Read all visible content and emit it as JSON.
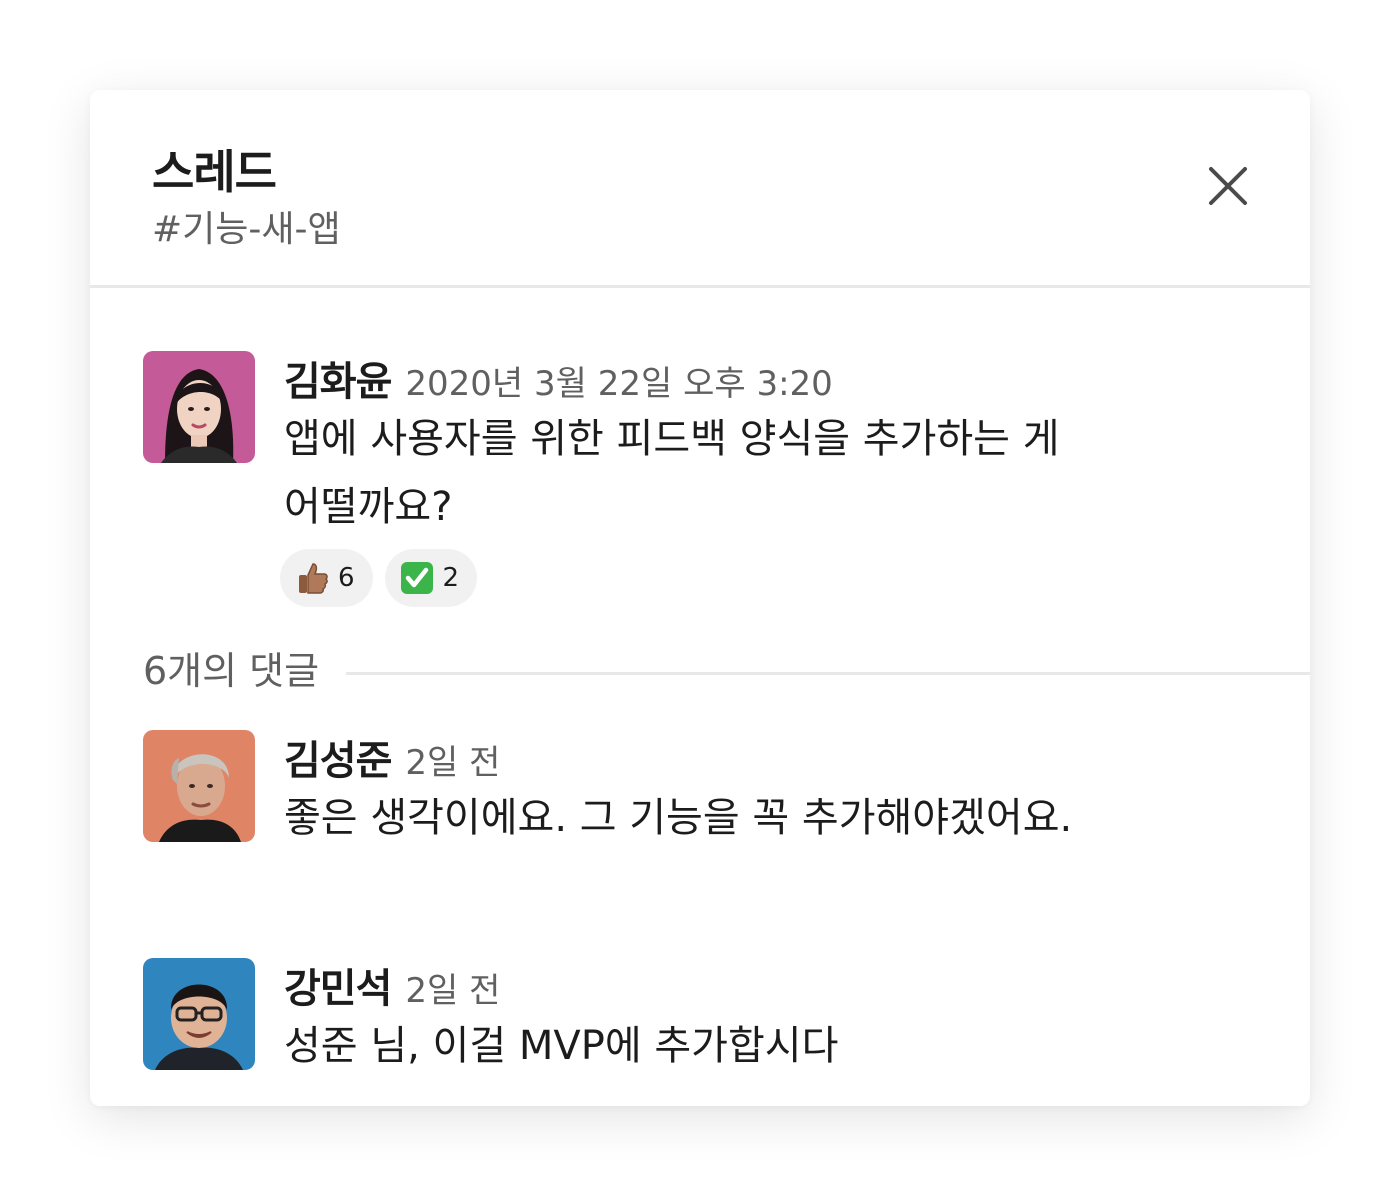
{
  "header": {
    "title": "스레드",
    "channel": "#기능-새-앱",
    "close_icon": "close-icon"
  },
  "parent_message": {
    "author": "김화윤",
    "timestamp": "2020년 3월 22일 오후 3:20",
    "text_line1": "앱에 사용자를 위한 피드백 양식을 추가하는 게",
    "text_line2": "어떨까요?",
    "reactions": [
      {
        "emoji": "thumbs-up-medium-skin-tone",
        "count": "6"
      },
      {
        "emoji": "white-check-mark",
        "count": "2"
      }
    ]
  },
  "replies_label": "6개의 댓글",
  "replies": [
    {
      "author": "김성준",
      "timestamp": "2일 전",
      "text": "좋은 생각이에요. 그 기능을 꼭 추가해야겠어요."
    },
    {
      "author": "강민석",
      "timestamp": "2일 전",
      "text": "성준 님, 이걸 MVP에 추가합시다"
    }
  ],
  "colors": {
    "text_primary": "#1d1c1d",
    "text_secondary": "#616061",
    "divider": "#e8e8e8",
    "reaction_bg": "#f1f1f1",
    "avatar1_bg": "#c45a98",
    "avatar2_bg": "#e08466",
    "avatar3_bg": "#2f86bf"
  }
}
